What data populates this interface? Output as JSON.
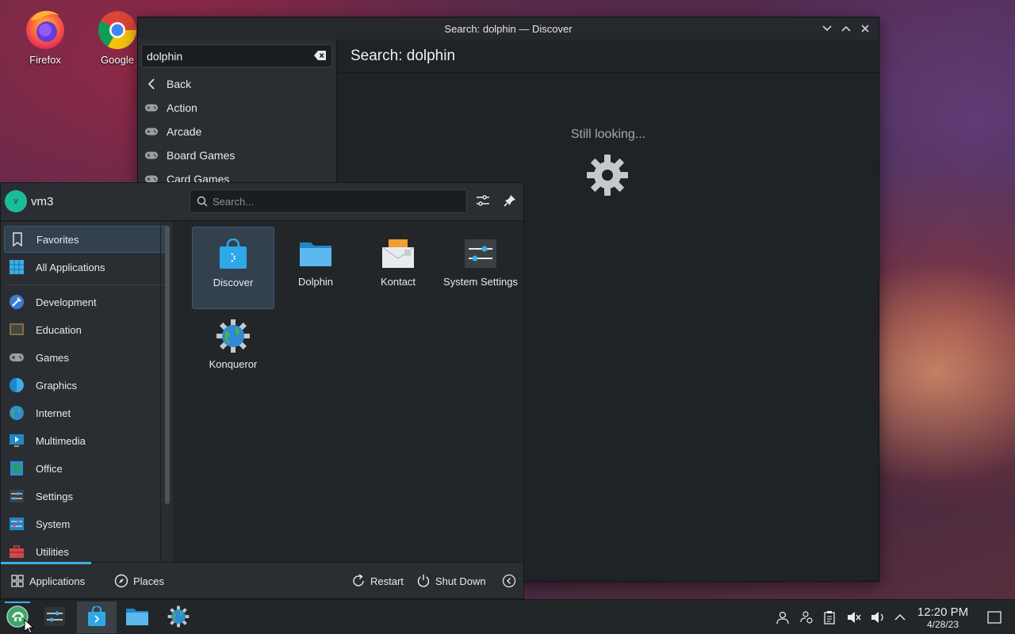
{
  "desktop": {
    "icons": [
      {
        "label": "Firefox"
      },
      {
        "label": "Google"
      }
    ]
  },
  "discover": {
    "title": "Search: dolphin — Discover",
    "search_value": "dolphin",
    "sidebar": [
      "Back",
      "Action",
      "Arcade",
      "Board Games",
      "Card Games"
    ],
    "header": "Search: dolphin",
    "status": "Still looking..."
  },
  "kickoff": {
    "user": "vm3",
    "avatar_letter": "v",
    "search_placeholder": "Search...",
    "categories": [
      "Favorites",
      "All Applications",
      "Development",
      "Education",
      "Games",
      "Graphics",
      "Internet",
      "Multimedia",
      "Office",
      "Settings",
      "System",
      "Utilities"
    ],
    "favorites": [
      {
        "label": "Discover"
      },
      {
        "label": "Dolphin"
      },
      {
        "label": "Kontact"
      },
      {
        "label": "System Settings"
      },
      {
        "label": "Konqueror"
      }
    ],
    "footer": {
      "applications": "Applications",
      "places": "Places",
      "restart": "Restart",
      "shutdown": "Shut Down"
    }
  },
  "taskbar": {
    "time": "12:20 PM",
    "date": "4/28/23"
  },
  "colors": {
    "accent": "#3daee9",
    "panel": "#232629",
    "selection": "#33414f"
  }
}
